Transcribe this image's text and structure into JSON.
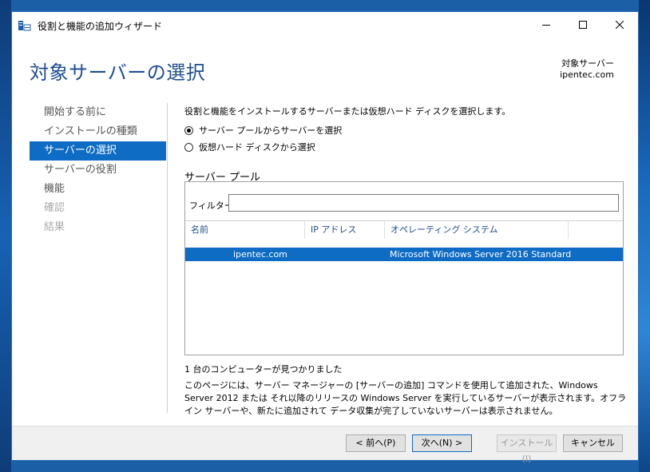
{
  "window": {
    "title": "役割と機能の追加ウィザード"
  },
  "header": {
    "page_title": "対象サーバーの選択",
    "destination_label": "対象サーバー",
    "destination_value": "ipentec.com"
  },
  "nav": {
    "items": [
      {
        "label": "開始する前に",
        "state": "normal"
      },
      {
        "label": "インストールの種類",
        "state": "normal"
      },
      {
        "label": "サーバーの選択",
        "state": "active"
      },
      {
        "label": "サーバーの役割",
        "state": "normal"
      },
      {
        "label": "機能",
        "state": "normal"
      },
      {
        "label": "確認",
        "state": "disabled"
      },
      {
        "label": "結果",
        "state": "disabled"
      }
    ]
  },
  "main": {
    "instruction": "役割と機能をインストールするサーバーまたは仮想ハード ディスクを選択します。",
    "radio_pool": "サーバー プールからサーバーを選択",
    "radio_vhd": "仮想ハード ディスクから選択",
    "pool_group_label": "サーバー プール",
    "filter_label": "フィルター:",
    "filter_value": "",
    "columns": [
      "名前",
      "IP アドレス",
      "オペレーティング システム"
    ],
    "rows": [
      {
        "name": "ipentec.com",
        "ip": "",
        "os": "Microsoft Windows Server 2016 Standard"
      }
    ],
    "count_text": "1 台のコンピューターが見つかりました",
    "description": "このページには、サーバー マネージャーの [サーバーの追加] コマンドを使用して追加された、Windows Server 2012 または それ以降のリリースの Windows Server を実行しているサーバーが表示されます。オフライン サーバーや、新たに追加されて データ収集が完了していないサーバーは表示されません。"
  },
  "footer": {
    "prev_label": "< 前へ(P)",
    "next_label": "次へ(N) >",
    "install_label": "インストール(I)",
    "cancel_label": "キャンセル"
  },
  "colors": {
    "accent": "#0e6cc4",
    "title_blue": "#1e4d91"
  }
}
